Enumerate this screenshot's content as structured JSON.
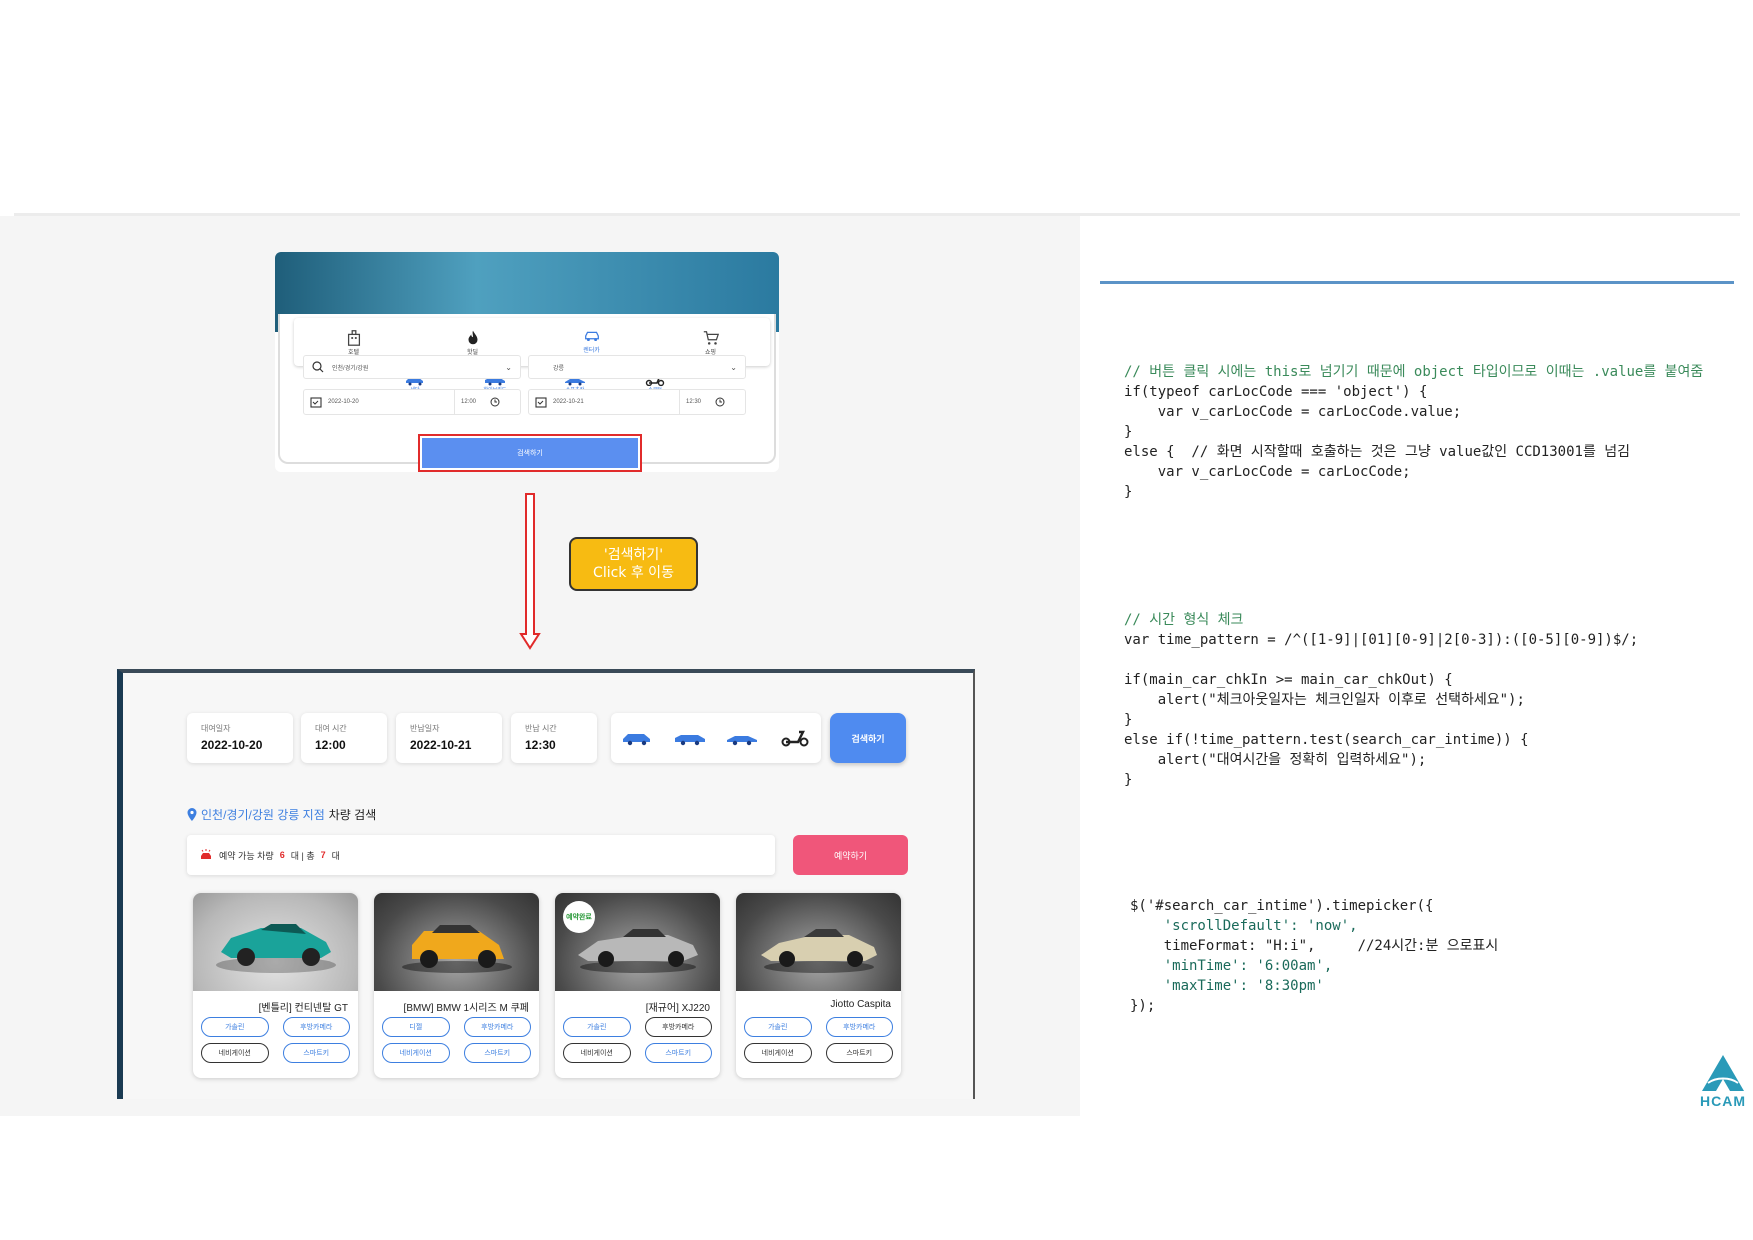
{
  "top_screenshot": {
    "tabs": [
      {
        "label": "호텔",
        "icon": "hotel-icon"
      },
      {
        "label": "핫딜",
        "icon": "fire-icon"
      },
      {
        "label": "렌터카",
        "icon": "car-icon"
      },
      {
        "label": "쇼핑",
        "icon": "cart-icon"
      }
    ],
    "car_types": [
      "세단",
      "하이브리드",
      "스포츠카",
      "스쿠터"
    ],
    "location_select": "인천/경기/강원",
    "branch_select": "강릉",
    "pickup_date": "2022-10-20",
    "pickup_time": "12:00",
    "return_date": "2022-10-21",
    "return_time": "12:30",
    "search_label": "검색하기"
  },
  "callout": {
    "line1": "'검색하기'",
    "line2": "Click 후 이동"
  },
  "bottom_screenshot": {
    "chips": [
      {
        "label": "대여일자",
        "value": "2022-10-20"
      },
      {
        "label": "대여 시간",
        "value": "12:00"
      },
      {
        "label": "반납일자",
        "value": "2022-10-21"
      },
      {
        "label": "반납 시간",
        "value": "12:30"
      }
    ],
    "search_label": "검색하기",
    "location_text": "인천/경기/강원 강릉 지점",
    "location_tail": "차량 검색",
    "avail_prefix": "예약 가능 차량",
    "avail_count": "6",
    "avail_mid": "대 | 총",
    "avail_total": "7",
    "avail_suffix": "대",
    "reserve_label": "예약하기",
    "cars": [
      {
        "name": "[벤틀리] 컨티넨탈 GT",
        "tags": [
          "가솔린",
          "후방카메라",
          "네비게이션",
          "스마트키"
        ],
        "badge": ""
      },
      {
        "name": "[BMW] BMW 1시리즈 M 쿠페",
        "tags": [
          "디젤",
          "후방카메라",
          "네비게이션",
          "스마트키"
        ],
        "badge": ""
      },
      {
        "name": "[재규어] XJ220",
        "tags": [
          "가솔린",
          "후방카메라",
          "네비게이션",
          "스마트키"
        ],
        "badge": "예약완료"
      },
      {
        "name": "Jiotto Caspita",
        "tags": [
          "가솔린",
          "후방카메라",
          "네비게이션",
          "스마트키"
        ],
        "badge": ""
      }
    ]
  },
  "code_blocks": {
    "block1": [
      "// 버튼 클릭 시에는 this로 넘기기 때문에 object 타입이므로 이때는 .value를 붙여줌",
      "if(typeof carLocCode === 'object') {",
      "    var v_carLocCode = carLocCode.value;",
      "}",
      "else {  // 화면 시작할때 호출하는 것은 그냥 value값인 CCD13001를 넘김",
      "    var v_carLocCode = carLocCode;",
      "}"
    ],
    "block2": [
      "// 시간 형식 체크",
      "var time_pattern = /^([1-9]|[01][0-9]|2[0-3]):([0-5][0-9])$/;",
      "",
      "if(main_car_chkIn >= main_car_chkOut) {",
      "    alert(\"체크아웃일자는 체크인일자 이후로 선택하세요\");",
      "}",
      "else if(!time_pattern.test(search_car_intime)) {",
      "    alert(\"대여시간을 정확히 입력하세요\");",
      "}"
    ],
    "block3": [
      "$('#search_car_intime').timepicker({",
      "    'scrollDefault': 'now',",
      "    timeFormat: \"H:i\",     //24시간:분 으로표시",
      "    'minTime': '6:00am',",
      "    'maxTime': '8:30pm'",
      "});"
    ]
  },
  "logo_text": "HCAM",
  "colors": {
    "accent_blue": "#5b8ff0",
    "highlight_red": "#e12b2b",
    "callout_yellow": "#f7bb12",
    "reserve_pink": "#f0567a"
  }
}
